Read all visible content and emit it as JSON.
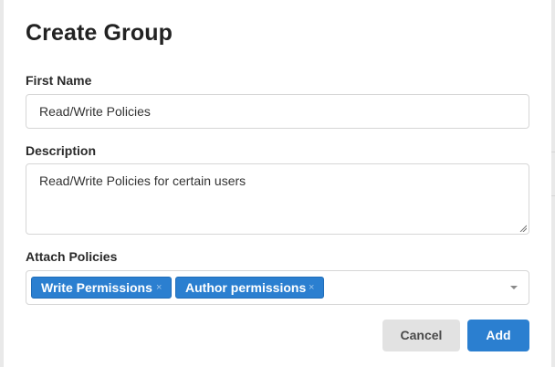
{
  "dialog": {
    "title": "Create Group"
  },
  "fields": {
    "first_name": {
      "label": "First Name",
      "value": "Read/Write Policies"
    },
    "description": {
      "label": "Description",
      "value": "Read/Write Policies for certain users"
    },
    "attach_policies": {
      "label": "Attach Policies",
      "tags": [
        {
          "label": "Write Permissions",
          "remove_icon": "×"
        },
        {
          "label": "Author permissions",
          "remove_icon": "×"
        }
      ]
    }
  },
  "actions": {
    "cancel_label": "Cancel",
    "add_label": "Add"
  },
  "colors": {
    "accent": "#2b7fd0",
    "cancel_bg": "#e2e2e2"
  }
}
